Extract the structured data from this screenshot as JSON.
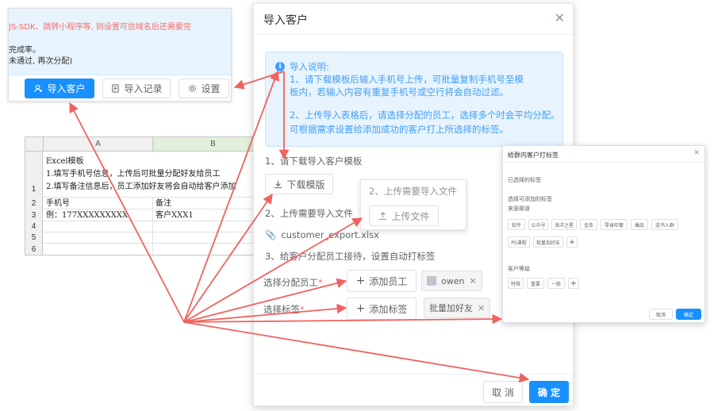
{
  "top_card": {
    "line1": "JS-SDK、跳转小程序等, 则设置可信域名后还需要完",
    "line2": "完成率。",
    "line3": "未通过, 再次分配)",
    "import_btn": "导入客户",
    "records_btn": "导入记录",
    "settings_btn": "设置"
  },
  "excel": {
    "col_a": "A",
    "col_b": "B",
    "rows": [
      "1",
      "2",
      "3",
      "4",
      "5",
      "6"
    ],
    "r1_l1": "Excel模板",
    "r1_l2": "1.填写手机号信息，上传后可批量分配好友给员工",
    "r1_l3": "2.填写备注信息后，员工添加好友将会自动给客户添加",
    "a2": "手机号",
    "b2": "备注",
    "a3": "例：177XXXXXXXXX",
    "b3": "客户XXX1"
  },
  "dialog": {
    "title": "导入客户",
    "alert_title": "导入说明:",
    "alert_l1": "1、请下载模板后输入手机号上传，可批量复制手机号至模",
    "alert_l2": "板内，若输入内容有重复手机号或空行将会自动过滤。",
    "alert_l3": "2、上传导入表格后，请选择分配的员工，选择多个时会平均分配。",
    "alert_l4": "可根据需求设置给添加成功的客户打上所选择的标签。",
    "step1": "1、请下载导入客户模板",
    "download_btn": "下载模版",
    "step2": "2、上传需要导入文件",
    "file_name": "customer_export.xlsx",
    "step3": "3、给客户分配员工接待，设置自动打标签",
    "assign_label": "选择分配员工",
    "add_staff_btn": "添加员工",
    "staff_tag": "owen",
    "tags_label": "选择标签",
    "add_tag_btn": "添加标签",
    "selected_tag": "批量加好友",
    "cancel_btn": "取 消",
    "confirm_btn": "确 定",
    "required_mark": "*"
  },
  "upload_popup": {
    "title": "2、上传需要导入文件",
    "upload_btn": "上传文件"
  },
  "tag_dialog": {
    "title": "给群内客户打标签",
    "selected_heading": "已选择的标签",
    "available_heading": "选择可添加的标签",
    "group1_name": "来源渠道",
    "group1_tags": [
      "知乎",
      "公众号",
      "海洋之星",
      "金条",
      "零食旺奢",
      "爆品",
      "送书入群",
      "PS课程",
      "批量加好友"
    ],
    "group2_name": "客户等级",
    "group2_tags": [
      "特殊",
      "重要",
      "一般"
    ],
    "cancel_btn": "取消",
    "confirm_btn": "确定"
  },
  "colors": {
    "primary": "#1890ff",
    "arrow": "#f0625e",
    "danger": "#f56c6c",
    "alert_bg": "#e8f4fd"
  }
}
